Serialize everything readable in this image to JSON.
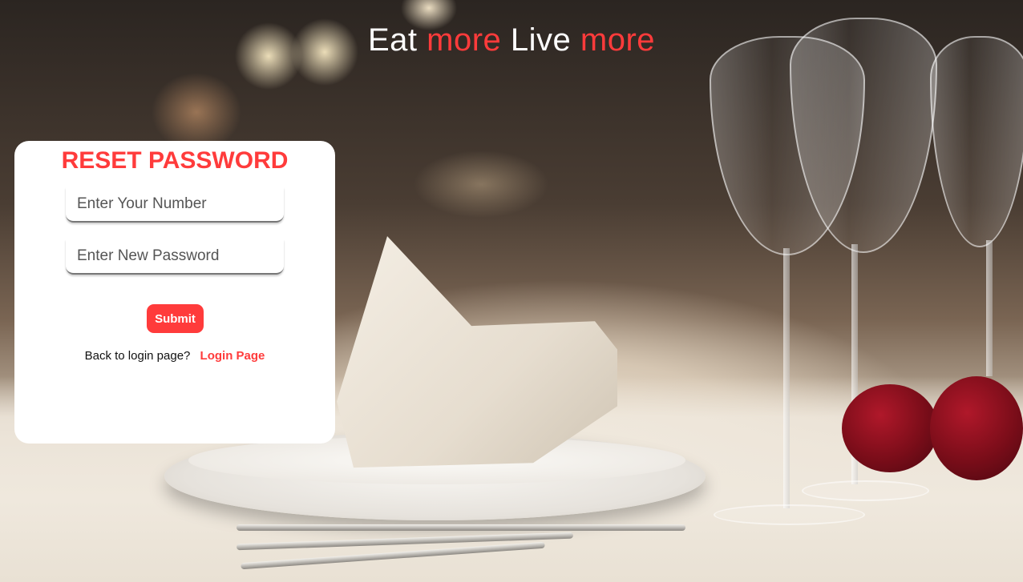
{
  "headline": {
    "word1": "Eat",
    "word2": "more",
    "word3": "Live",
    "word4": "more"
  },
  "reset_card": {
    "title": "RESET PASSWORD",
    "number_placeholder": "Enter Your Number",
    "password_placeholder": "Enter New Password",
    "submit_label": "Submit",
    "back_text": "Back to login page?",
    "login_link_label": "Login Page"
  },
  "colors": {
    "accent": "#ff3b3b",
    "card_bg": "#ffffff",
    "headline_text": "#ffffff"
  },
  "background": {
    "scene": "restaurant-table-image"
  }
}
